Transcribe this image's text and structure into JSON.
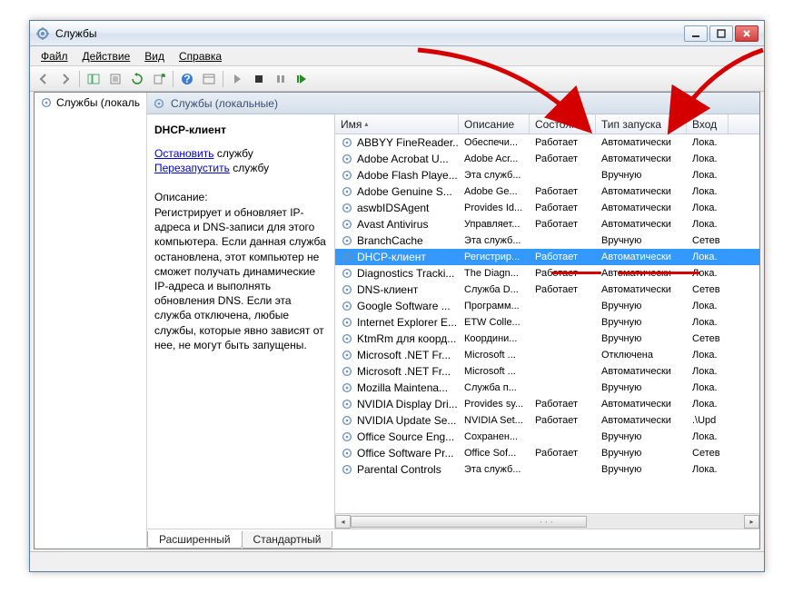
{
  "window": {
    "title": "Службы"
  },
  "menu": {
    "file": "Файл",
    "action": "Действие",
    "view": "Вид",
    "help": "Справка"
  },
  "tree": {
    "root": "Службы (локаль"
  },
  "header": {
    "title": "Службы (локальные)"
  },
  "detail": {
    "name": "DHCP-клиент",
    "stop_link": "Остановить",
    "stop_tail": " службу",
    "restart_link": "Перезапустить",
    "restart_tail": " службу",
    "desc_label": "Описание:",
    "desc_text": "Регистрирует и обновляет IP-адреса и DNS-записи для этого компьютера. Если данная служба остановлена, этот компьютер не сможет получать динамические IP-адреса и выполнять обновления DNS. Если эта служба отключена, любые службы, которые явно зависят от нее, не могут быть запущены."
  },
  "columns": {
    "name": "Имя",
    "desc": "Описание",
    "state": "Состояние",
    "startup": "Тип запуска",
    "logon": "Вход"
  },
  "services": [
    {
      "name": "ABBYY FineReader...",
      "desc": "Обеспечи...",
      "state": "Работает",
      "startup": "Автоматически",
      "logon": "Лока."
    },
    {
      "name": "Adobe Acrobat U...",
      "desc": "Adobe Acr...",
      "state": "Работает",
      "startup": "Автоматически",
      "logon": "Лока."
    },
    {
      "name": "Adobe Flash Playe...",
      "desc": "Эта служб...",
      "state": "",
      "startup": "Вручную",
      "logon": "Лока."
    },
    {
      "name": "Adobe Genuine S...",
      "desc": "Adobe Ge...",
      "state": "Работает",
      "startup": "Автоматически",
      "logon": "Лока."
    },
    {
      "name": "aswbIDSAgent",
      "desc": "Provides Id...",
      "state": "Работает",
      "startup": "Автоматически",
      "logon": "Лока."
    },
    {
      "name": "Avast Antivirus",
      "desc": "Управляет...",
      "state": "Работает",
      "startup": "Автоматически",
      "logon": "Лока."
    },
    {
      "name": "BranchCache",
      "desc": "Эта служб...",
      "state": "",
      "startup": "Вручную",
      "logon": "Сетев"
    },
    {
      "name": "DHCP-клиент",
      "desc": "Регистрир...",
      "state": "Работает",
      "startup": "Автоматически",
      "logon": "Лока.",
      "selected": true
    },
    {
      "name": "Diagnostics Tracki...",
      "desc": "The Diagn...",
      "state": "Работает",
      "startup": "Автоматически",
      "logon": "Лока."
    },
    {
      "name": "DNS-клиент",
      "desc": "Служба D...",
      "state": "Работает",
      "startup": "Автоматически",
      "logon": "Сетев"
    },
    {
      "name": "Google Software ...",
      "desc": "Программ...",
      "state": "",
      "startup": "Вручную",
      "logon": "Лока."
    },
    {
      "name": "Internet Explorer E...",
      "desc": "ETW Colle...",
      "state": "",
      "startup": "Вручную",
      "logon": "Лока."
    },
    {
      "name": "KtmRm для коорд...",
      "desc": "Координи...",
      "state": "",
      "startup": "Вручную",
      "logon": "Сетев"
    },
    {
      "name": "Microsoft .NET Fr...",
      "desc": "Microsoft ...",
      "state": "",
      "startup": "Отключена",
      "logon": "Лока."
    },
    {
      "name": "Microsoft .NET Fr...",
      "desc": "Microsoft ...",
      "state": "",
      "startup": "Автоматически",
      "logon": "Лока."
    },
    {
      "name": "Mozilla Maintena...",
      "desc": "Служба п...",
      "state": "",
      "startup": "Вручную",
      "logon": "Лока."
    },
    {
      "name": "NVIDIA Display Dri...",
      "desc": "Provides sy...",
      "state": "Работает",
      "startup": "Автоматически",
      "logon": "Лока."
    },
    {
      "name": "NVIDIA Update Se...",
      "desc": "NVIDIA Set...",
      "state": "Работает",
      "startup": "Автоматически",
      "logon": ".\\Upd"
    },
    {
      "name": "Office  Source Eng...",
      "desc": "Сохранен...",
      "state": "",
      "startup": "Вручную",
      "logon": "Лока."
    },
    {
      "name": "Office Software Pr...",
      "desc": "Office Sof...",
      "state": "Работает",
      "startup": "Вручную",
      "logon": "Сетев"
    },
    {
      "name": "Parental Controls",
      "desc": "Эта служб...",
      "state": "",
      "startup": "Вручную",
      "logon": "Лока."
    }
  ],
  "tabs": {
    "extended": "Расширенный",
    "standard": "Стандартный"
  }
}
